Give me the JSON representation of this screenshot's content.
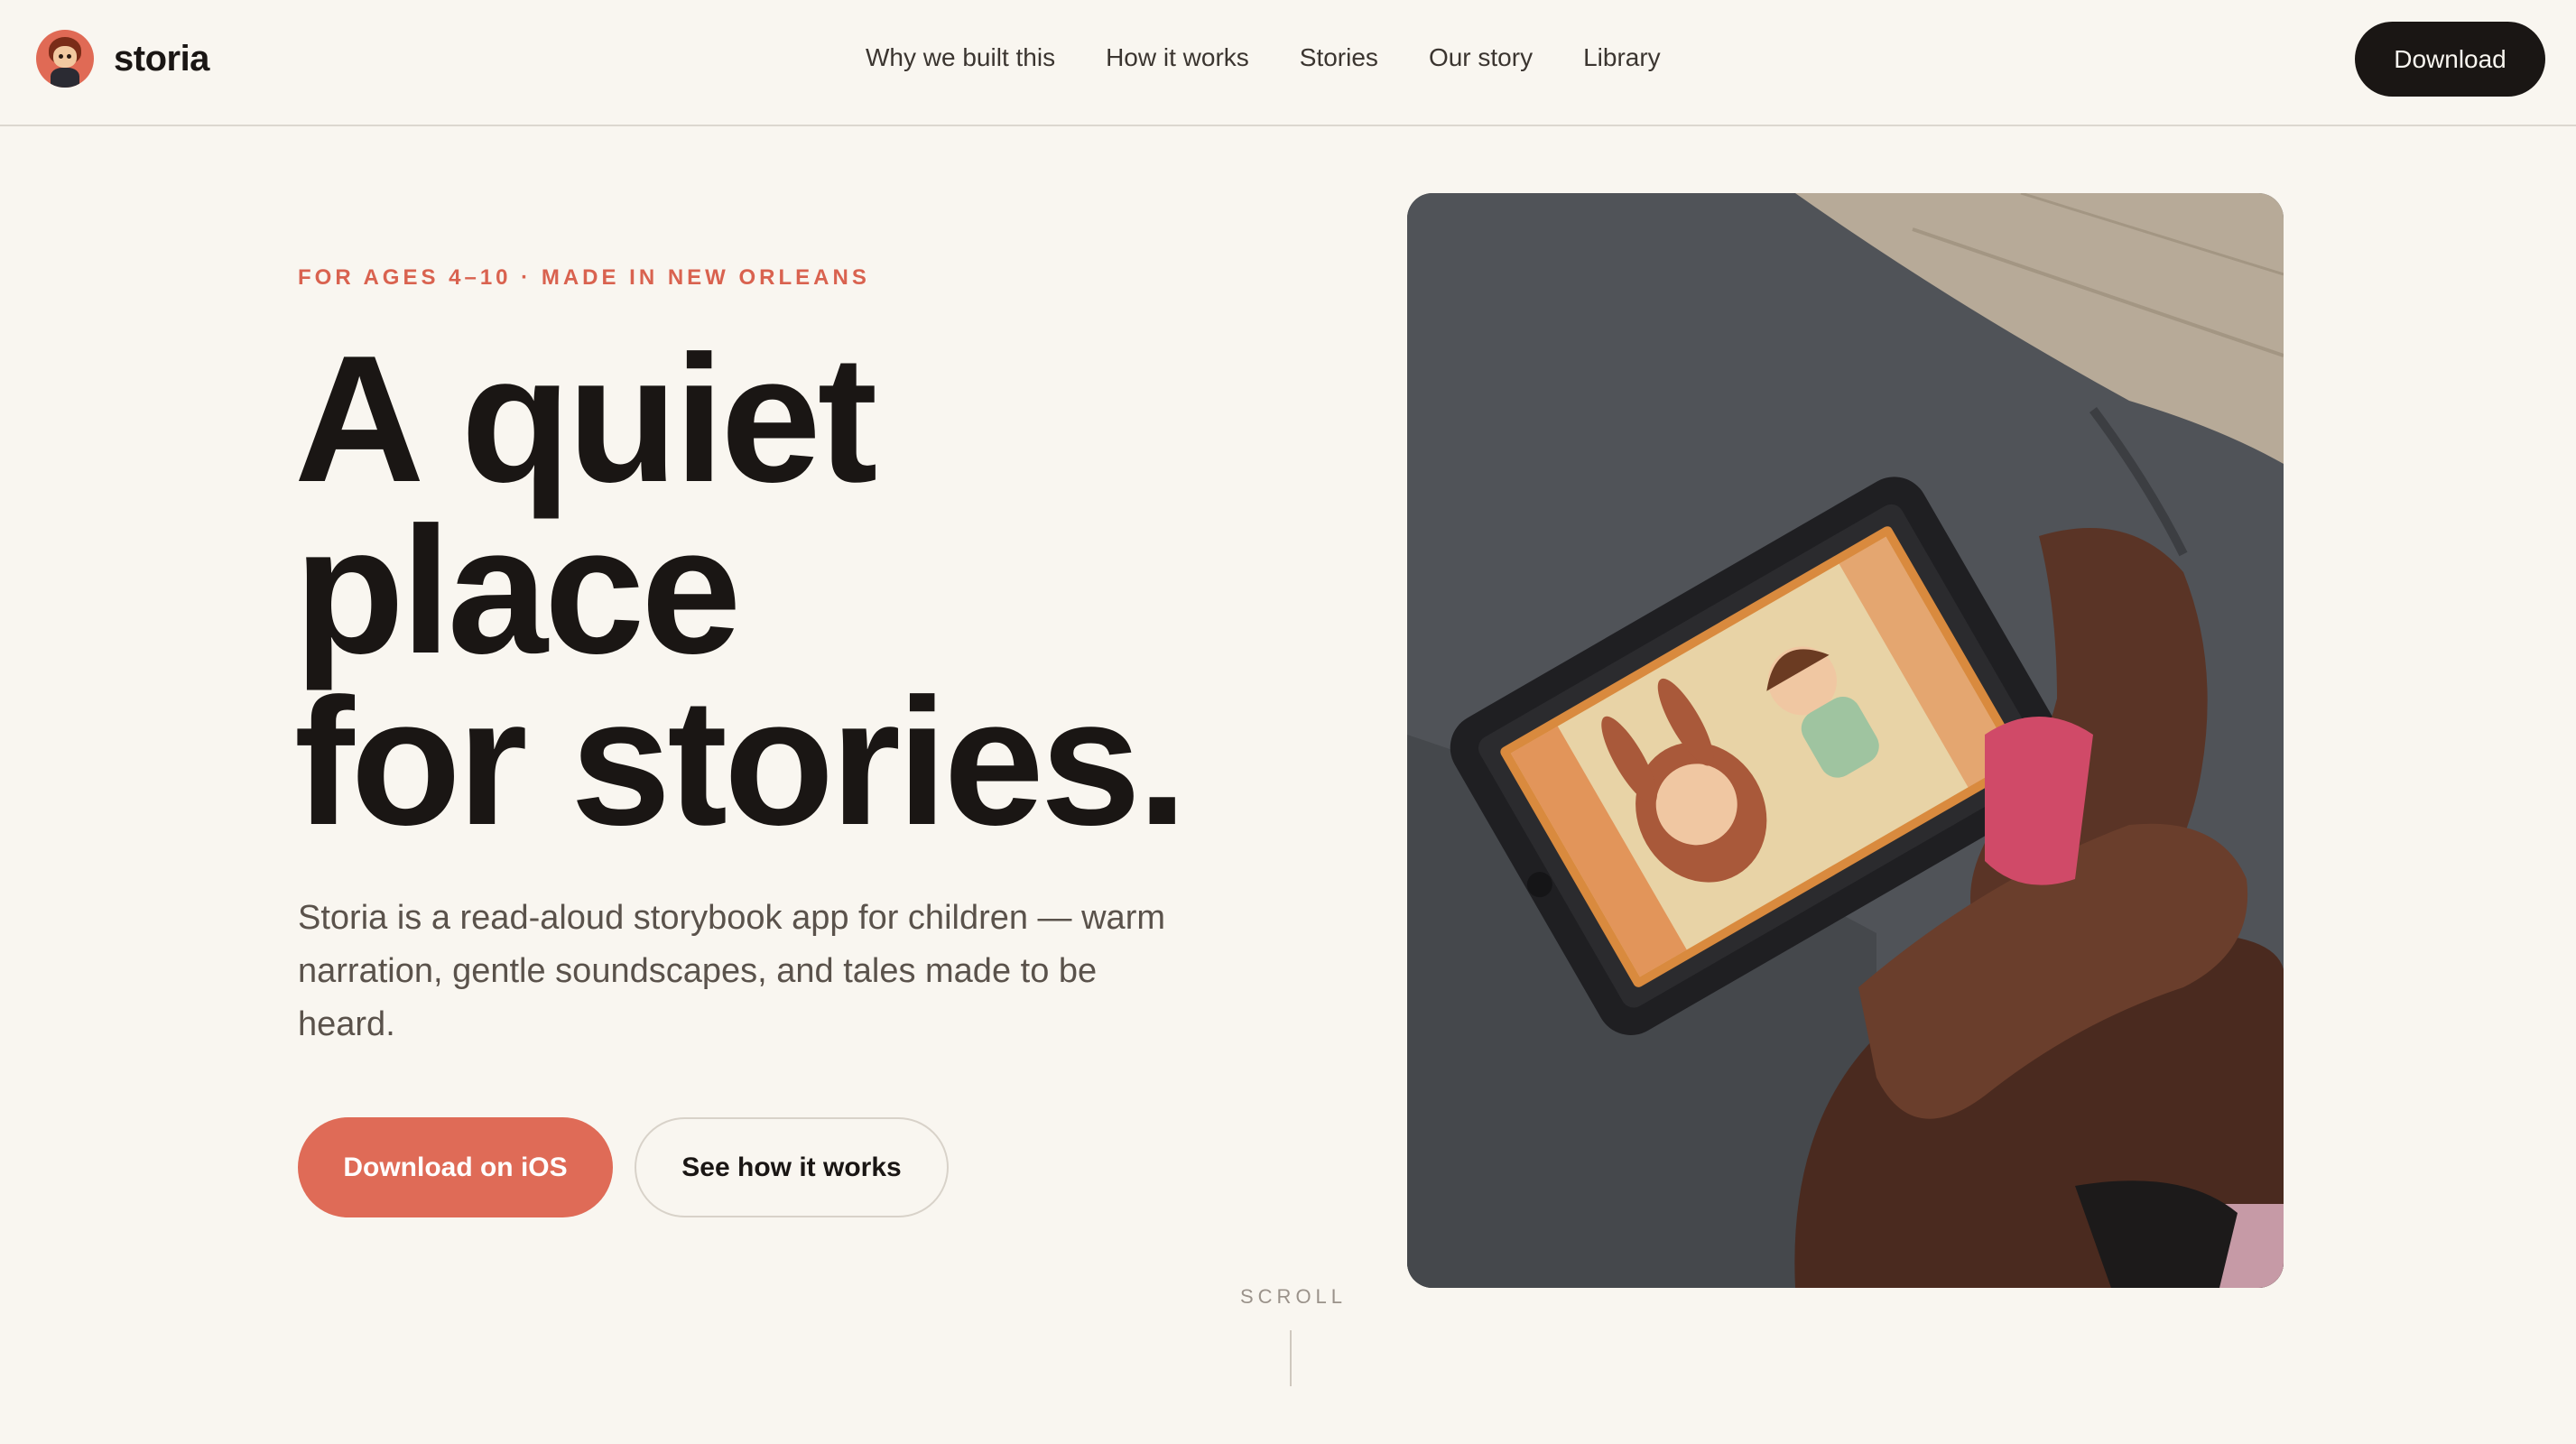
{
  "nav": {
    "brand_name": "storia",
    "logo_icon": "storia-avatar-logo",
    "links": [
      "Why we built this",
      "How it works",
      "Stories",
      "Our story",
      "Library"
    ],
    "download_label": "Download"
  },
  "hero": {
    "eyebrow": "FOR AGES 4–10 · MADE IN NEW ORLEANS",
    "headline": [
      "A quiet",
      "place",
      "for stories."
    ],
    "subtitle": "Storia is a read-aloud storybook app for children — warm narration, gentle soundscapes, and tales made to be heard.",
    "primary_cta": "Download on iOS",
    "secondary_cta": "See how it works",
    "scroll_label": "SCROLL",
    "photo_icon": "child-reading-tablet-photo"
  },
  "colors": {
    "background": "#f9f6f0",
    "accent": "#df6b57",
    "text": "#1a1614",
    "muted": "#5a524b"
  }
}
